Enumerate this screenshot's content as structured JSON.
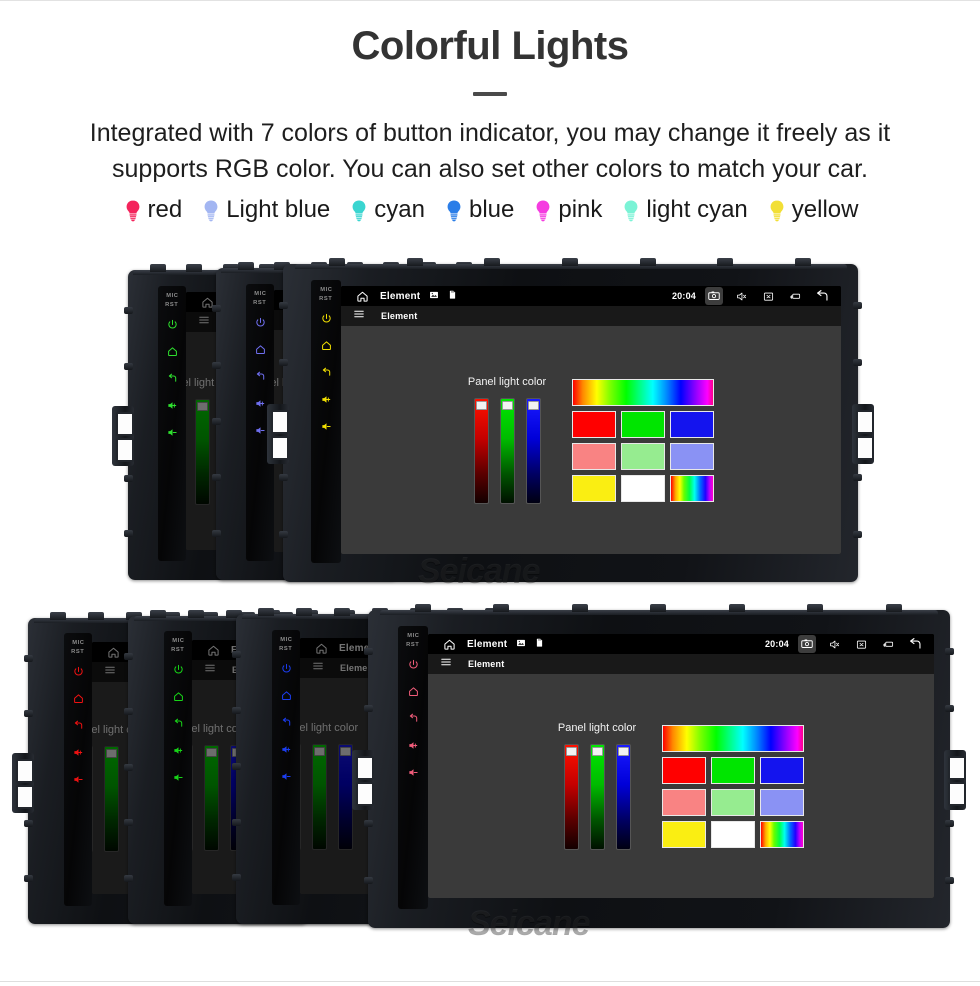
{
  "header": {
    "title": "Colorful Lights",
    "subtitle": "Integrated with 7 colors of button indicator, you may change it freely as it supports RGB color. You can also set other colors to match your car."
  },
  "legend": {
    "items": [
      {
        "label": "red",
        "color": "#f4245c",
        "icon": "bulb-icon"
      },
      {
        "label": "Light blue",
        "color": "#a3b6f2",
        "icon": "bulb-icon"
      },
      {
        "label": "cyan",
        "color": "#3ad5d0",
        "icon": "bulb-icon"
      },
      {
        "label": "blue",
        "color": "#2b7ee8",
        "icon": "bulb-icon"
      },
      {
        "label": "pink",
        "color": "#f53ce0",
        "icon": "bulb-icon"
      },
      {
        "label": "light cyan",
        "color": "#7bf3d6",
        "icon": "bulb-icon"
      },
      {
        "label": "yellow",
        "color": "#f2df36",
        "icon": "bulb-icon"
      }
    ]
  },
  "device": {
    "button_strip": {
      "labels": [
        "MIC",
        "RST"
      ],
      "buttons": [
        {
          "name": "power-button",
          "icon": "power-icon"
        },
        {
          "name": "home-button",
          "icon": "home-outline-icon"
        },
        {
          "name": "back-button",
          "icon": "back-arrow-icon"
        },
        {
          "name": "volume-up-button",
          "icon": "volume-up-icon"
        },
        {
          "name": "volume-down-button",
          "icon": "volume-down-icon"
        }
      ]
    },
    "status_bar": {
      "home_icon": "home-icon",
      "title": "Element",
      "icons_left": [
        "picture-icon",
        "sd-card-icon"
      ],
      "clock": "20:04",
      "icons_right": [
        "camera-icon",
        "mute-speaker-icon",
        "close-box-icon",
        "recents-icon",
        "back-arrow-icon"
      ]
    },
    "app_bar": {
      "menu_icon": "hamburger-menu-icon",
      "title": "Element"
    },
    "panel": {
      "label": "Panel light color",
      "sliders": [
        {
          "name": "red-slider",
          "channel": "R"
        },
        {
          "name": "green-slider",
          "channel": "G"
        },
        {
          "name": "blue-slider",
          "channel": "B"
        }
      ],
      "swatches": [
        {
          "name": "hue-strip",
          "color": "hue-gradient"
        },
        {
          "name": "swatch-red",
          "color": "#ff0000"
        },
        {
          "name": "swatch-green",
          "color": "#00e500"
        },
        {
          "name": "swatch-blue",
          "color": "#1414ee"
        },
        {
          "name": "swatch-salmon",
          "color": "#f98383"
        },
        {
          "name": "swatch-mint",
          "color": "#96ec90"
        },
        {
          "name": "swatch-periwinkle",
          "color": "#8a92f4"
        },
        {
          "name": "swatch-yellow",
          "color": "#faee12"
        },
        {
          "name": "swatch-white",
          "color": "#ffffff"
        },
        {
          "name": "swatch-rainbow",
          "color": "hue-gradient"
        }
      ]
    }
  },
  "groups": {
    "top": {
      "watermark": "Seicane",
      "units": [
        {
          "indicator_color": "#2ee02e",
          "name": "unit-green"
        },
        {
          "indicator_color": "#6f6ff0",
          "name": "unit-light-blue"
        },
        {
          "indicator_color": "#f2e000",
          "name": "unit-yellow"
        }
      ]
    },
    "bottom": {
      "watermark": "Seicane",
      "units": [
        {
          "indicator_color": "#ee1111",
          "name": "unit-red"
        },
        {
          "indicator_color": "#17d417",
          "name": "unit-green"
        },
        {
          "indicator_color": "#1b3df0",
          "name": "unit-blue"
        },
        {
          "indicator_color": "#f05c7a",
          "name": "unit-pink"
        }
      ]
    }
  }
}
